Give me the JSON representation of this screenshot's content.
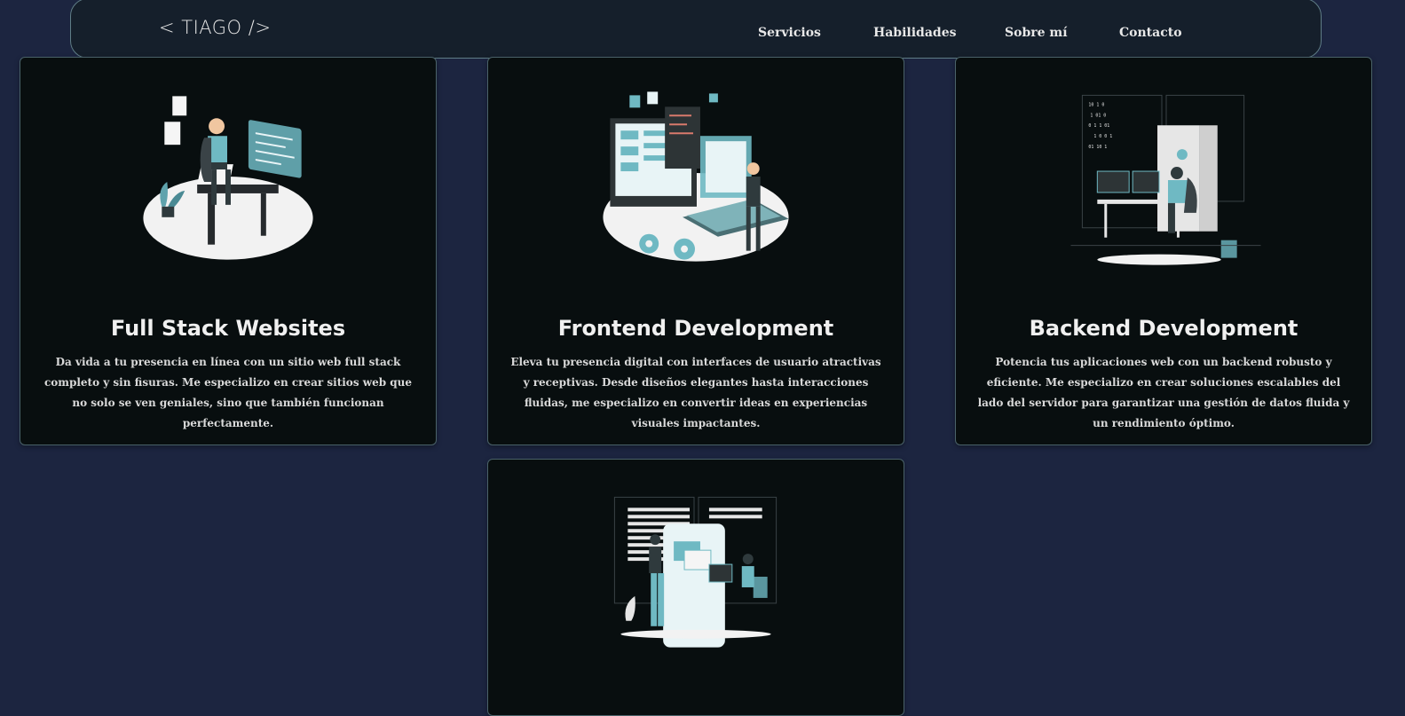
{
  "header": {
    "logo": "< TIAGO />",
    "nav": [
      "Servicios",
      "Habilidades",
      "Sobre mí",
      "Contacto"
    ]
  },
  "services": [
    {
      "title": "Full Stack Websites",
      "description": "Da vida a tu presencia en línea con un sitio web full stack completo y sin fisuras. Me especializo en crear sitios web que no solo se ven geniales, sino que también funcionan perfectamente.",
      "illustration": "developer-at-desk-illustration"
    },
    {
      "title": "Frontend Development",
      "description": "Eleva tu presencia digital con interfaces de usuario atractivas y receptivas. Desde diseños elegantes hasta interacciones fluidas, me especializo en convertir ideas en experiencias visuales impactantes.",
      "illustration": "frontend-screens-illustration"
    },
    {
      "title": "Backend Development",
      "description": "Potencia tus aplicaciones web con un backend robusto y eficiente. Me especializo en crear soluciones escalables del lado del servidor para garantizar una gestión de datos fluida y un rendimiento óptimo.",
      "illustration": "backend-code-illustration"
    },
    {
      "title": "",
      "description": "",
      "illustration": "team-collaboration-illustration"
    }
  ],
  "colors": {
    "background": "#1c2540",
    "card": "#080e0f",
    "accent": "#6fb9c3",
    "navbar": "#151f2b"
  }
}
